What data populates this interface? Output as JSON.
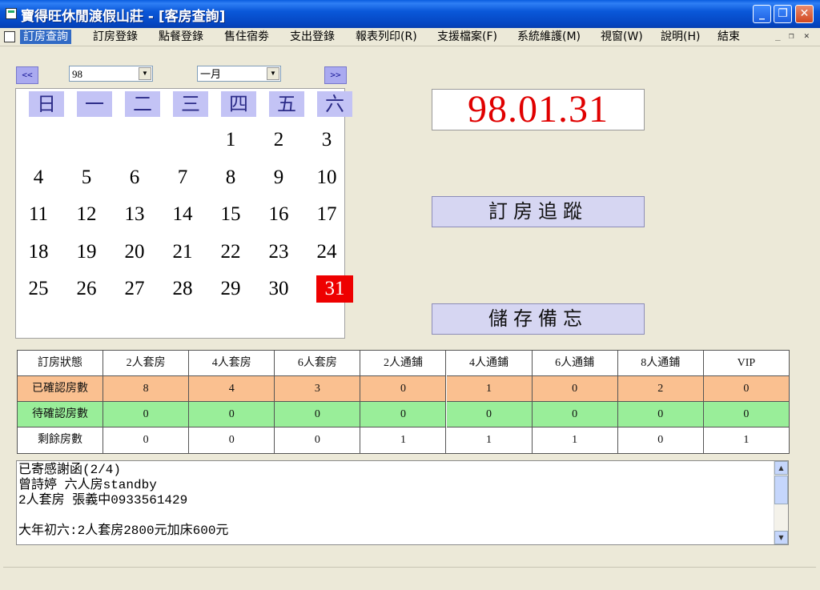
{
  "window": {
    "title": "寶得旺休閒渡假山莊 - [客房查詢]"
  },
  "menu": [
    {
      "label": "訂房查詢",
      "active": true
    },
    {
      "label": "訂房登錄"
    },
    {
      "label": "點餐登錄"
    },
    {
      "label": "售住宿劵"
    },
    {
      "label": "支出登錄"
    },
    {
      "label": "報表列印(R)"
    },
    {
      "label": "支援檔案(F)"
    },
    {
      "label": "系統維護(M)"
    },
    {
      "label": "視窗(W)"
    },
    {
      "label": "說明(H)"
    },
    {
      "label": "結束"
    }
  ],
  "calendar": {
    "prev_label": "<<",
    "next_label": ">>",
    "year": "98",
    "month": "一月",
    "weekdays": [
      "日",
      "一",
      "二",
      "三",
      "四",
      "五",
      "六"
    ],
    "days": [
      "1",
      "2",
      "3",
      "4",
      "5",
      "6",
      "7",
      "8",
      "9",
      "10",
      "11",
      "12",
      "13",
      "14",
      "15",
      "16",
      "17",
      "18",
      "19",
      "20",
      "21",
      "22",
      "23",
      "24",
      "25",
      "26",
      "27",
      "28",
      "29",
      "30",
      "31"
    ],
    "first_weekday_index": 4,
    "selected_day": "31"
  },
  "date_display": "98.01.31",
  "buttons": {
    "track": "訂房追蹤",
    "save_memo": "儲存備忘"
  },
  "status_table": {
    "headers": [
      "訂房狀態",
      "2人套房",
      "4人套房",
      "6人套房",
      "2人通鋪",
      "4人通鋪",
      "6人通鋪",
      "8人通鋪",
      "VIP"
    ],
    "rows": [
      {
        "label": "已確認房數",
        "values": [
          "8",
          "4",
          "3",
          "0",
          "1",
          "0",
          "2",
          "0"
        ]
      },
      {
        "label": "待確認房數",
        "values": [
          "0",
          "0",
          "0",
          "0",
          "0",
          "0",
          "0",
          "0"
        ]
      },
      {
        "label": "剩餘房數",
        "values": [
          "0",
          "0",
          "0",
          "1",
          "1",
          "1",
          "0",
          "1"
        ]
      }
    ]
  },
  "memo": {
    "lines": [
      "已寄感謝函(2/4)",
      "曾詩婷 六人房standby",
      "2人套房 張義中0933561429",
      "",
      "大年初六:2人套房2800元加床600元"
    ]
  },
  "colors": {
    "selected_day": "#ee0000",
    "date_text": "#e00000",
    "confirmed_row": "#fac090",
    "pending_row": "#99ee99"
  }
}
